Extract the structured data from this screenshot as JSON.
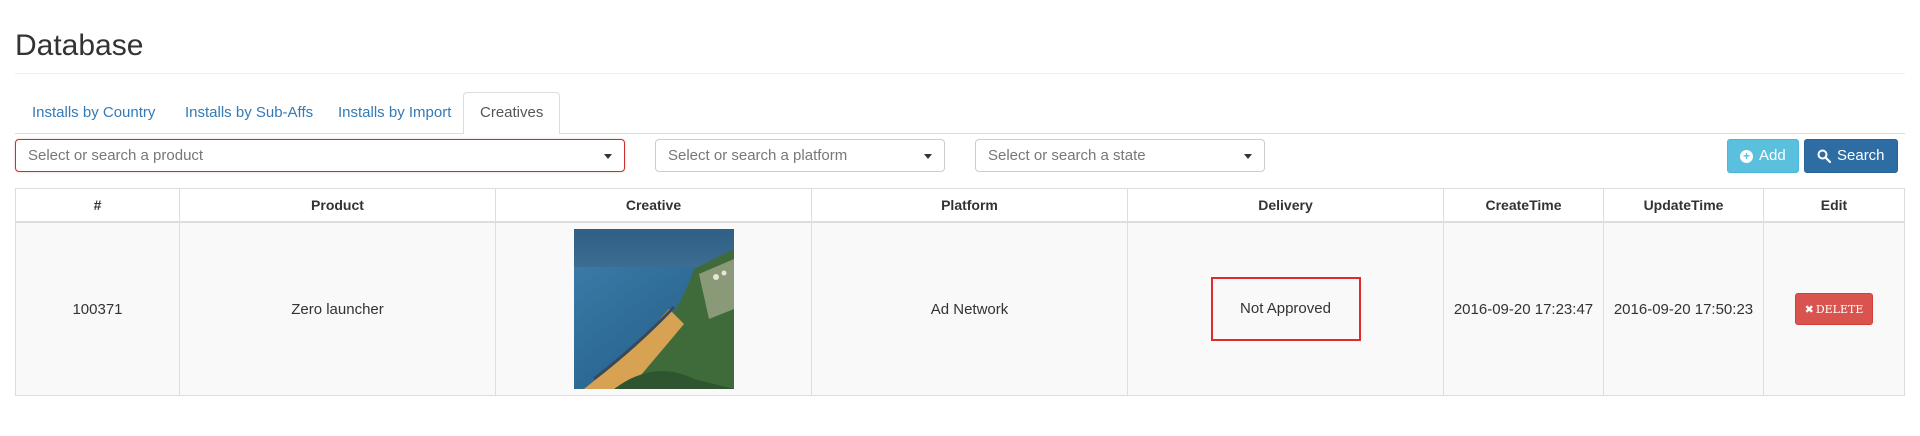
{
  "header": {
    "title": "Database"
  },
  "tabs": [
    {
      "label": "Installs by Country"
    },
    {
      "label": "Installs by Sub-Affs"
    },
    {
      "label": "Installs by Import"
    },
    {
      "label": "Creatives",
      "active": true
    }
  ],
  "filters": {
    "product": {
      "placeholder": "Select or search a product",
      "has_error": true
    },
    "platform": {
      "placeholder": "Select or search a platform"
    },
    "state": {
      "placeholder": "Select or search a state"
    }
  },
  "buttons": {
    "add_label": "Add",
    "search_label": "Search"
  },
  "table": {
    "columns": [
      "#",
      "Product",
      "Creative",
      "Platform",
      "Delivery",
      "CreateTime",
      "UpdateTime",
      "Edit"
    ],
    "rows": [
      {
        "id": "100371",
        "product": "Zero launcher",
        "creative": "beach-landscape-image",
        "platform": "Ad Network",
        "delivery": "Not Approved",
        "create_time": "2016-09-20 17:23:47",
        "update_time": "2016-09-20 17:50:23",
        "delete_label": "DELETE"
      }
    ]
  },
  "icons": {
    "add": "plus-circle-icon",
    "search": "search-icon",
    "delete": "x-icon",
    "dropdown": "caret-down-icon"
  },
  "colors": {
    "link": "#337ab7",
    "info": "#5bc0de",
    "primary": "#2e6da4",
    "danger": "#d9534f",
    "highlight": "#e02b2b"
  }
}
